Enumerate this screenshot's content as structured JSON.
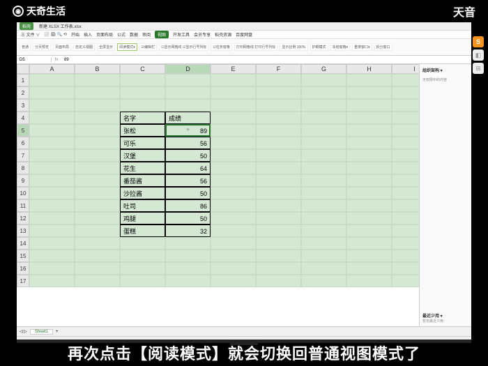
{
  "watermark": {
    "brand": "天奇生活",
    "right": "天音"
  },
  "titlebar": {
    "tab1": "稻壳",
    "tab2": "新建 XLSX 工作表.xlsx"
  },
  "menubar": {
    "items": [
      "三 文件 ∨",
      "⬜ 🖨 🔍 ⟲",
      "开始",
      "插入",
      "页面布局",
      "公式",
      "数据",
      "审阅"
    ],
    "active": "视图",
    "after": [
      "开发工具",
      "会员专享",
      "稻壳资源",
      "百度网盘"
    ]
  },
  "ribbon": {
    "btns": [
      "普通",
      "分页预览",
      "页面布局",
      "自定义视图",
      "全屏显示",
      "阅读模式▾",
      "☑编辑栏",
      "☑显示网格线 ☑显示行号列标",
      "☑任务窗格",
      "打印网格线 打印行号列标",
      "显示比例 100%",
      "护眼模式",
      "冻结窗格▾",
      "重排窗口▾",
      "拆分窗口"
    ]
  },
  "formulabar": {
    "name": "D5",
    "fx": "fx",
    "value": "89"
  },
  "cols": [
    "",
    "A",
    "B",
    "C",
    "D",
    "E",
    "F",
    "G",
    "H",
    "I"
  ],
  "selectedCol": 4,
  "selectedRow": 5,
  "header": {
    "name": "名字",
    "score": "成绩"
  },
  "rows": [
    {
      "name": "张松",
      "score": 89
    },
    {
      "name": "可乐",
      "score": 56
    },
    {
      "name": "汉堡",
      "score": 50
    },
    {
      "name": "花生",
      "score": 64
    },
    {
      "name": "番茄酱",
      "score": 56
    },
    {
      "name": "沙拉酱",
      "score": 50
    },
    {
      "name": "吐司",
      "score": 86
    },
    {
      "name": "鸡腿",
      "score": 50
    },
    {
      "name": "蛋糕",
      "score": 32
    }
  ],
  "totalRows": 17,
  "rightpanel": {
    "title": "组织架构 ▾",
    "sub": "无权限中的内容",
    "bottom1": "最近少用 ▾",
    "bottom2": "暂无最近少用"
  },
  "sheetbar": {
    "sheet": "Sheet1",
    "add": "+"
  },
  "side": {
    "s": "S"
  },
  "caption": "再次点击【阅读模式】就会切换回普通视图模式了",
  "chart_data": {
    "type": "table",
    "title": "成绩",
    "columns": [
      "名字",
      "成绩"
    ],
    "rows": [
      [
        "张松",
        89
      ],
      [
        "可乐",
        56
      ],
      [
        "汉堡",
        50
      ],
      [
        "花生",
        64
      ],
      [
        "番茄酱",
        56
      ],
      [
        "沙拉酱",
        50
      ],
      [
        "吐司",
        86
      ],
      [
        "鸡腿",
        50
      ],
      [
        "蛋糕",
        32
      ]
    ]
  }
}
